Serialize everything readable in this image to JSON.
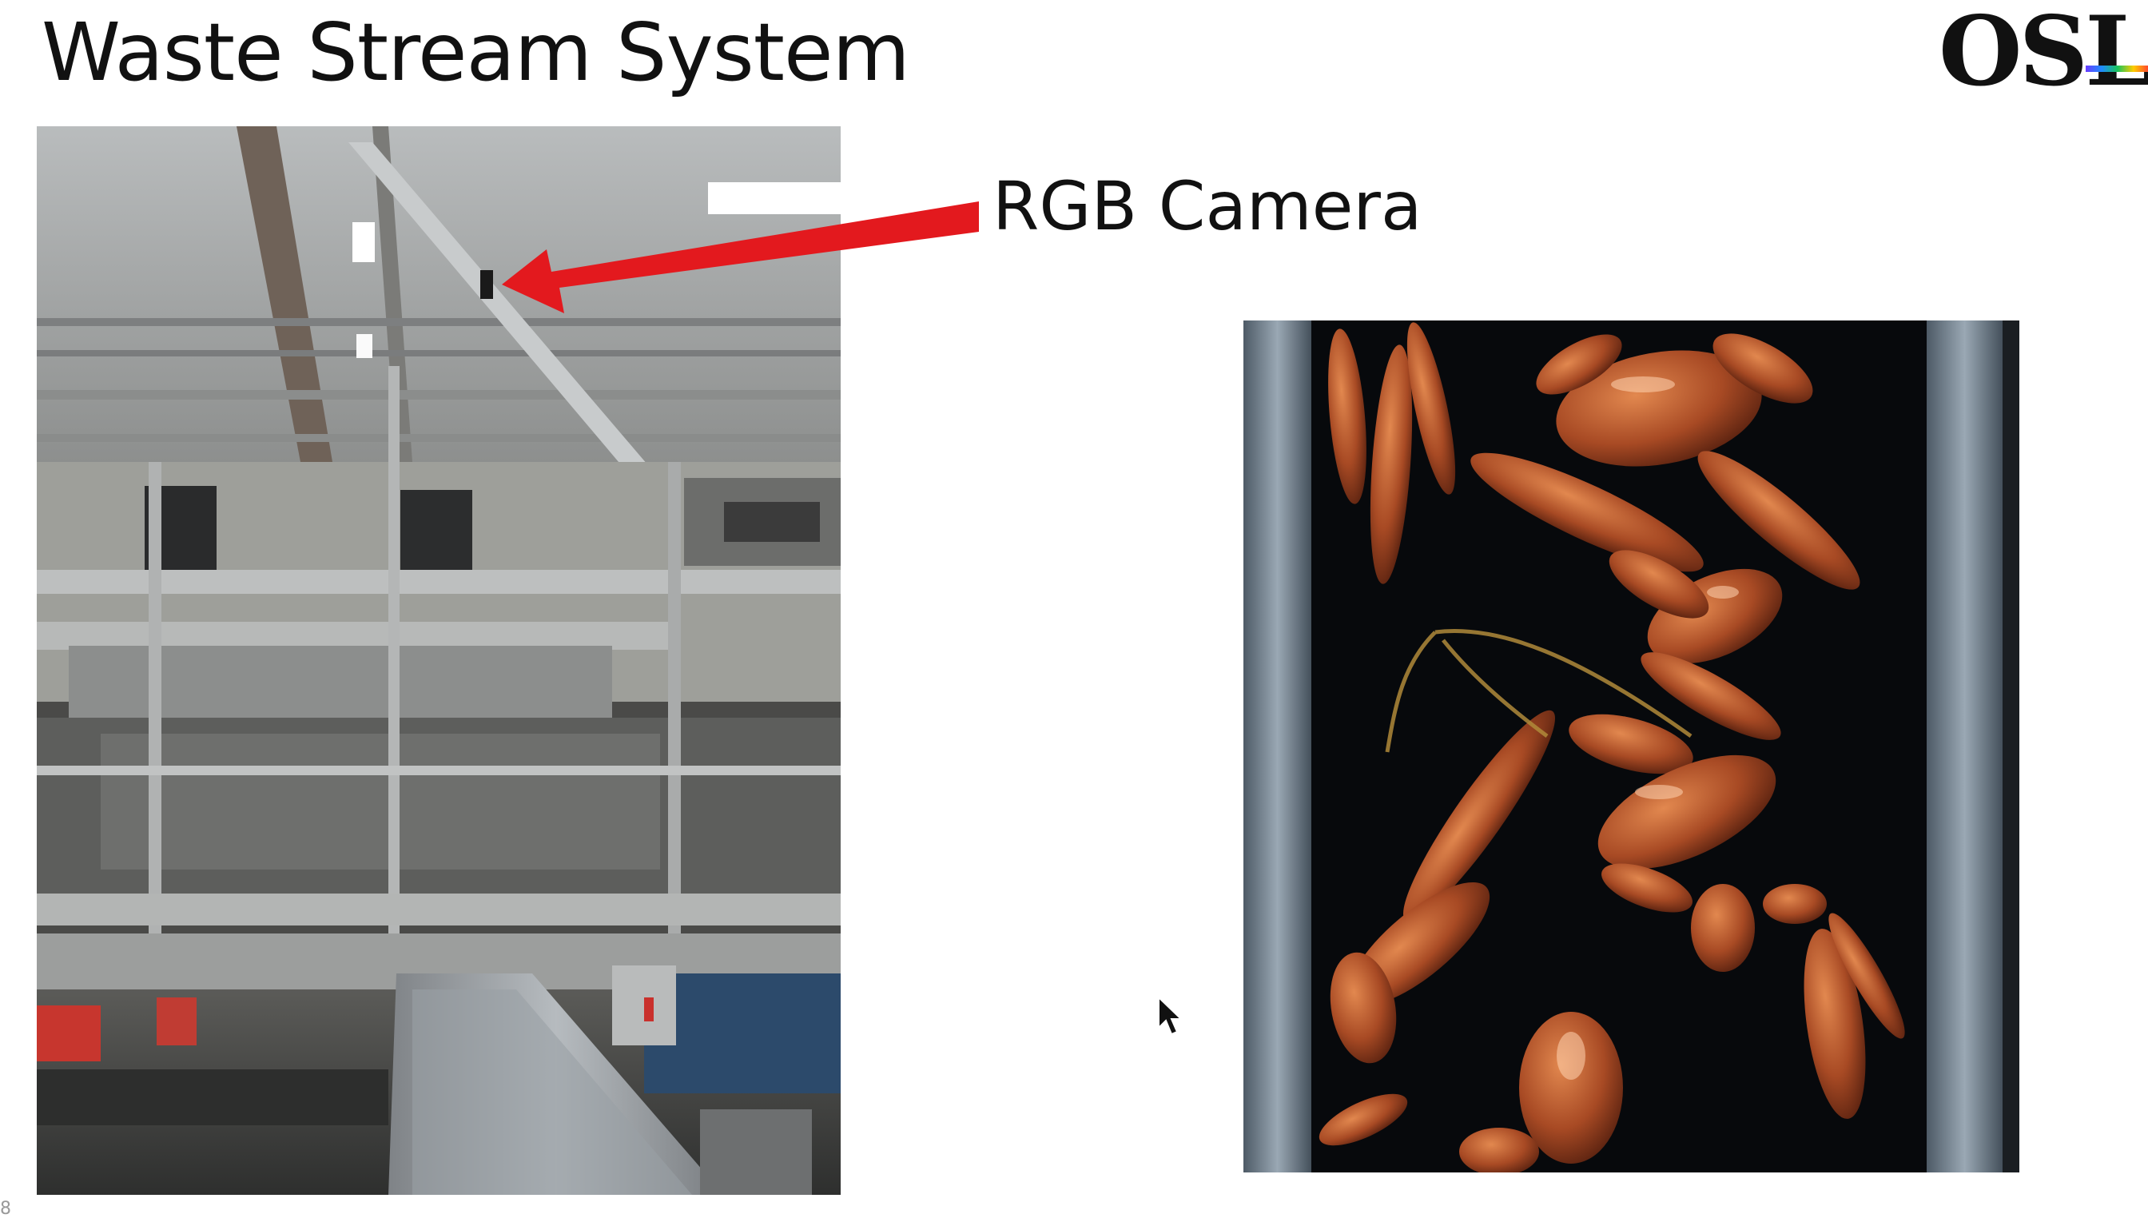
{
  "slide": {
    "title": "Waste Stream System",
    "callout_label": "RGB Camera",
    "logo_text": "OSL",
    "page_mark": "8"
  },
  "colors": {
    "arrow": "#e3191e",
    "background": "#ffffff",
    "text": "#111111"
  },
  "icons": {
    "cursor": "mouse-pointer-icon",
    "logo": "osl-logo-icon"
  }
}
